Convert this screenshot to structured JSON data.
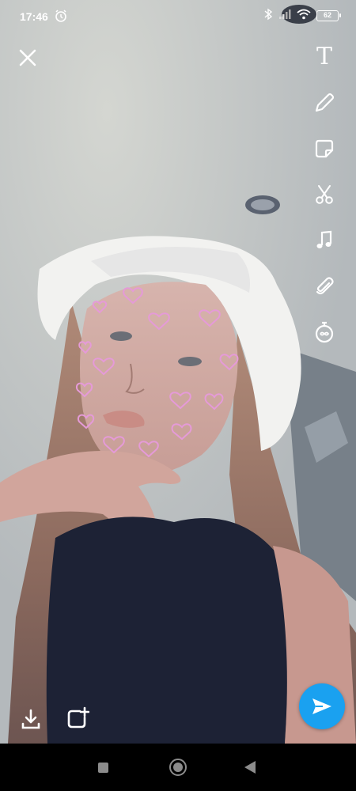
{
  "status_bar": {
    "time": "17:46",
    "battery": "62",
    "icons": [
      "alarm-icon",
      "bluetooth-icon",
      "signal-icon",
      "wifi-icon",
      "battery-icon"
    ]
  },
  "toolbar": {
    "close": "close-icon",
    "tools": [
      {
        "name": "text-tool",
        "glyph": "T"
      },
      {
        "name": "pencil-tool",
        "glyph": "pencil-icon"
      },
      {
        "name": "sticker-tool",
        "glyph": "sticker-icon"
      },
      {
        "name": "scissors-tool",
        "glyph": "scissors-icon"
      },
      {
        "name": "music-tool",
        "glyph": "music-note-icon"
      },
      {
        "name": "attachment-tool",
        "glyph": "paperclip-icon"
      },
      {
        "name": "timer-tool",
        "glyph": "timer-icon"
      }
    ]
  },
  "bottom_actions": {
    "download": "download-icon",
    "add_story": "add-story-icon",
    "send": "send-arrow-icon"
  },
  "colors": {
    "send_button": "#1aa1f0",
    "hearts": "#e59ad8",
    "icons": "#ffffff"
  },
  "filter": "pink-hearts-face-lens",
  "nav_bar": [
    "recents-square-icon",
    "home-circle-icon",
    "back-triangle-icon"
  ]
}
